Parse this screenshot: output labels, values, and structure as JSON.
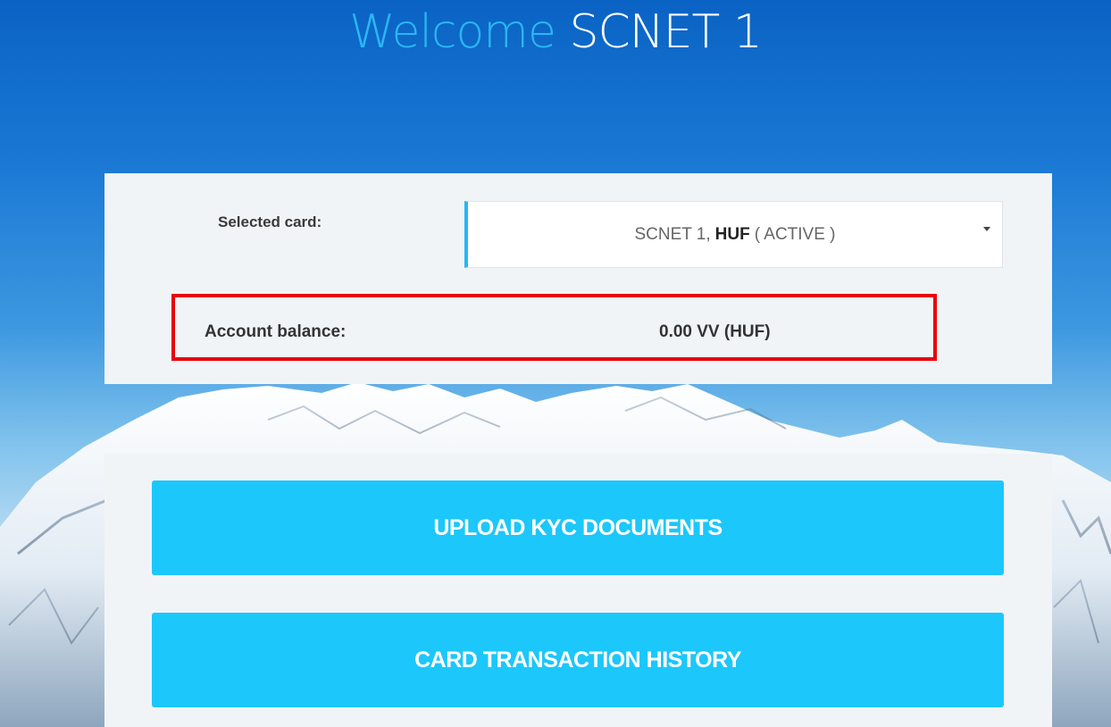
{
  "header": {
    "welcome_word": "Welcome",
    "username": "SCNET 1"
  },
  "card_section": {
    "selected_label": "Selected card:",
    "selected_card": {
      "name": "SCNET 1,",
      "currency": "HUF",
      "status": "( ACTIVE )"
    },
    "dropdown_icon": "caret-down-icon",
    "balance_label": "Account balance:",
    "balance_value": "0.00 VV (HUF)"
  },
  "actions": {
    "upload_kyc_label": "UPLOAD KYC DOCUMENTS",
    "transaction_history_label": "CARD TRANSACTION HISTORY"
  },
  "colors": {
    "accent": "#1cc7fb",
    "highlight_border": "#e8000b",
    "welcome_word": "#2bb6f3"
  }
}
